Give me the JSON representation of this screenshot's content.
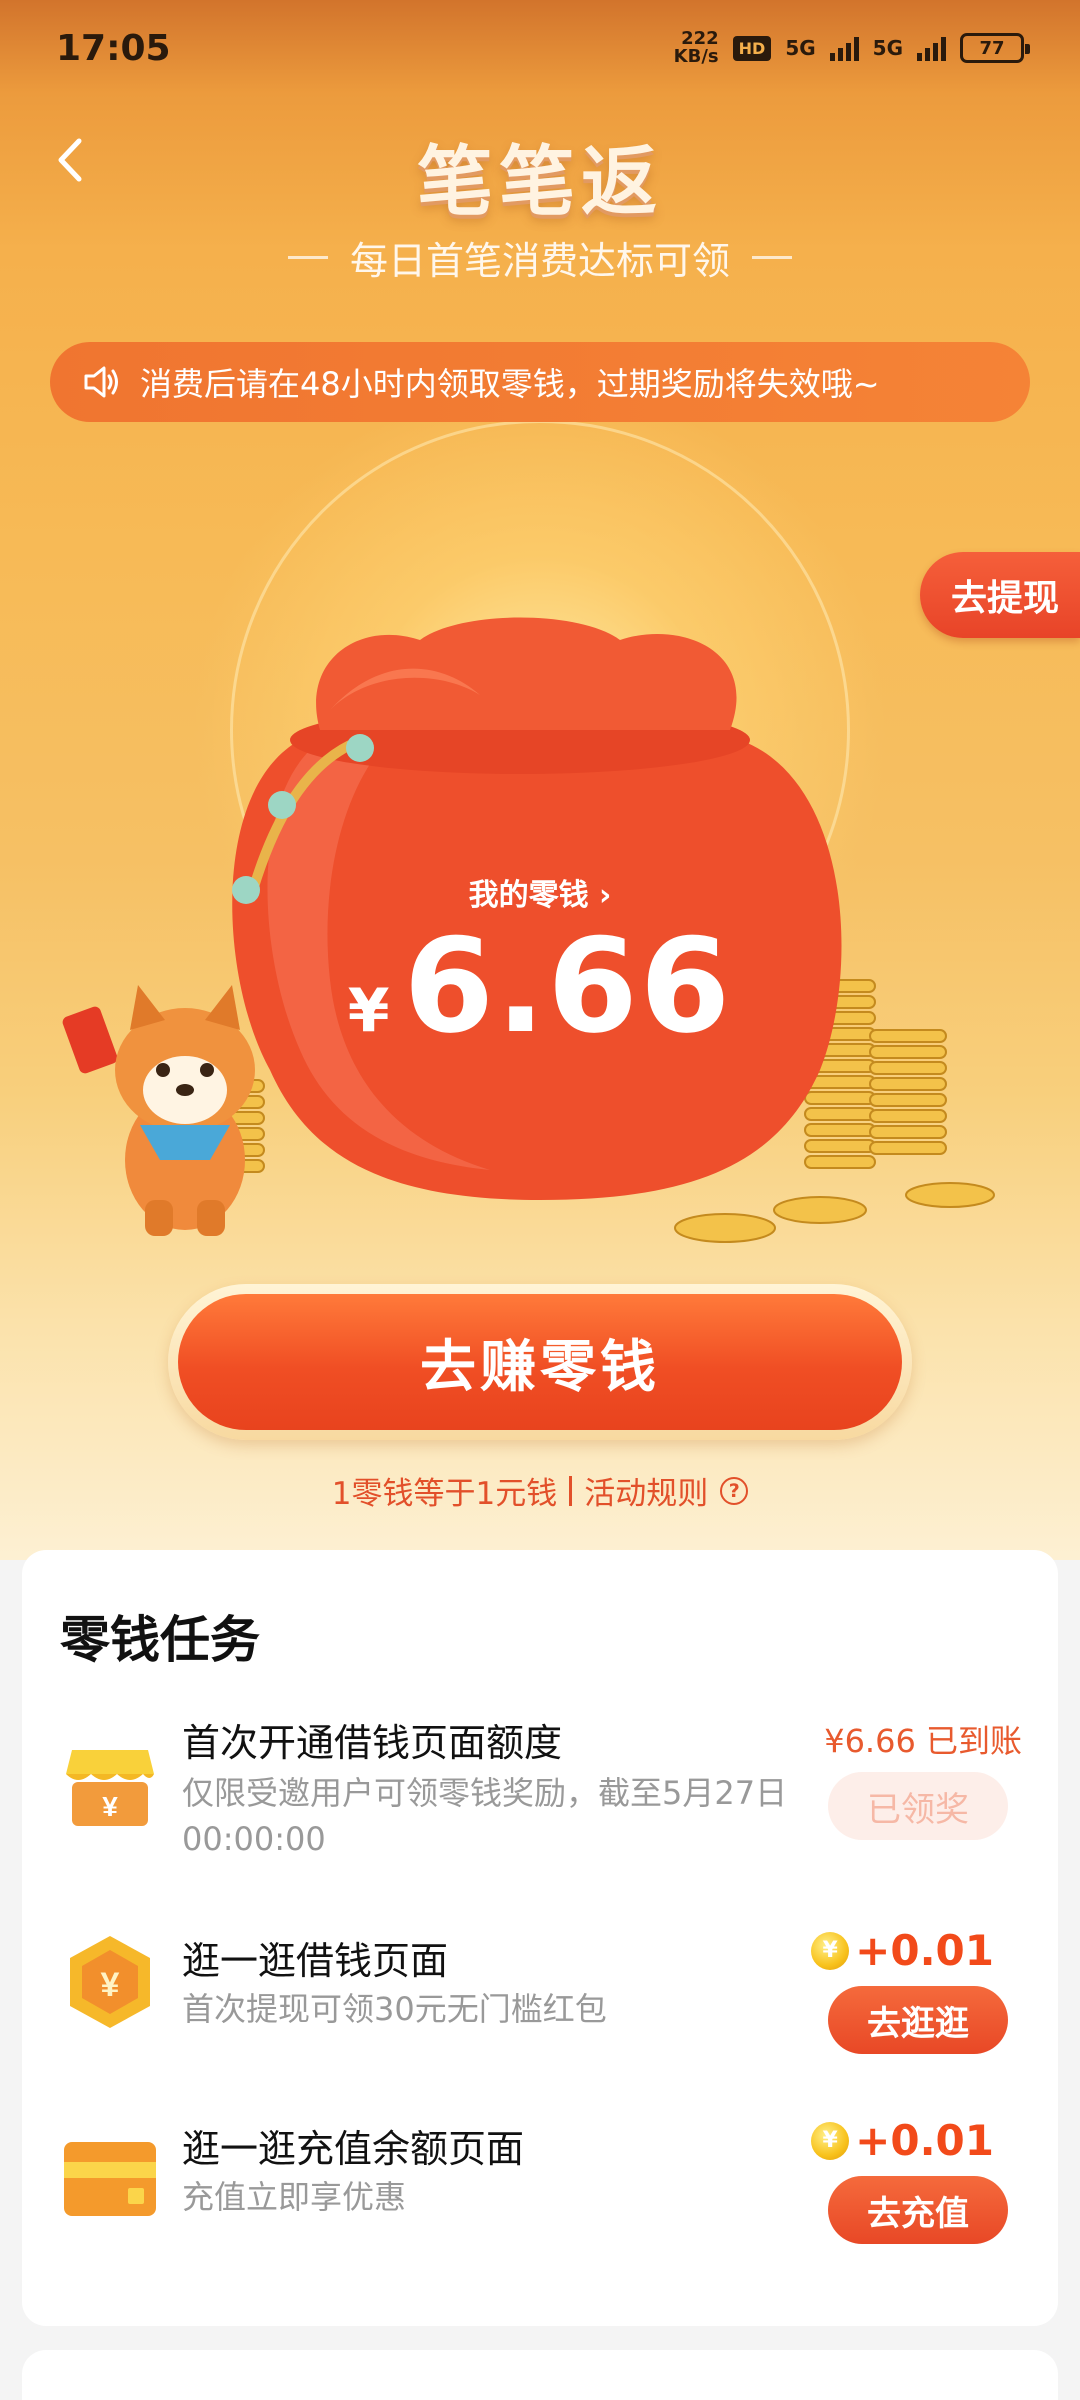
{
  "status_bar": {
    "time": "17:05",
    "net_speed_value": "222",
    "net_speed_unit": "KB/s",
    "hd_badge": "HD",
    "network_1": "5G",
    "network_2": "5G",
    "battery": "77"
  },
  "header": {
    "title": "笔笔返",
    "subtitle": "每日首笔消费达标可领"
  },
  "notice": {
    "text": "消费后请在48小时内领取零钱，过期奖励将失效哦~"
  },
  "withdraw_tab": "去提现",
  "balance": {
    "label": "我的零钱 ›",
    "currency": "¥",
    "amount": "6.66"
  },
  "earn_button": "去赚零钱",
  "rules": {
    "exchange_text": "1零钱等于1元钱",
    "rules_link": "活动规则",
    "help_glyph": "?"
  },
  "tasks": {
    "title": "零钱任务",
    "items": [
      {
        "title": "首次开通借钱页面额度",
        "desc": "仅限受邀用户可领零钱奖励，截至5月27日00:00:00",
        "reward": "¥6.66 已到账",
        "action": "已领奖",
        "icon": "shop-icon"
      },
      {
        "title": "逛一逛借钱页面",
        "desc": "首次提现可领30元无门槛红包",
        "coin_glyph": "¥",
        "reward": "+0.01",
        "action": "去逛逛",
        "icon": "yuan-hexagon-icon"
      },
      {
        "title": "逛一逛充值余额页面",
        "desc": "充值立即享优惠",
        "coin_glyph": "¥",
        "reward": "+0.01",
        "action": "去充值",
        "icon": "card-icon"
      }
    ]
  },
  "colors": {
    "accent": "#f04e24",
    "hero_top": "#d2742c",
    "hero_mid": "#f7ba56",
    "coin": "#f8c21c"
  }
}
